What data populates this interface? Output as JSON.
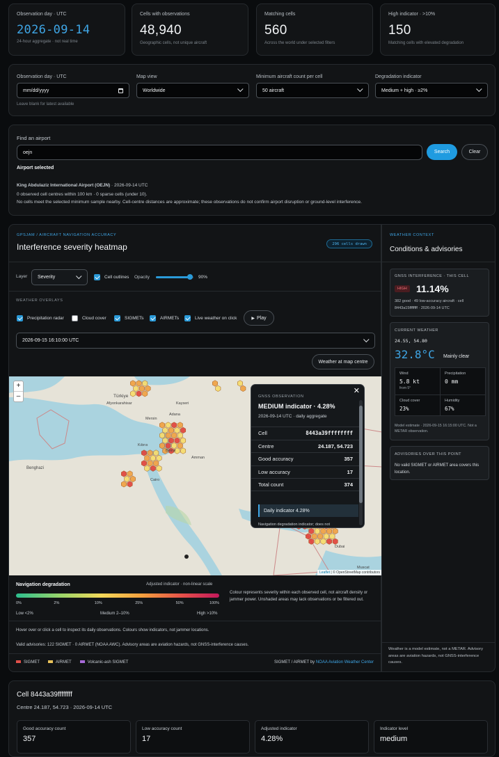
{
  "stats": [
    {
      "label": "Observation day · UTC",
      "value": "2026-09-14",
      "sub": "24-hour aggregate · not real time"
    },
    {
      "label": "Cells with observations",
      "value": "48,940",
      "sub": "Geographic cells, not unique aircraft"
    },
    {
      "label": "Matching cells",
      "value": "560",
      "sub": "Across the world under selected filters"
    },
    {
      "label": "High indicator · >10%",
      "value": "150",
      "sub": "Matching cells with elevated degradation"
    }
  ],
  "filters": {
    "day_label": "Observation day · UTC",
    "day_placeholder": "mm/dd/yyyy",
    "day_hint": "Leave blank for latest available",
    "view_label": "Map view",
    "view_value": "Worldwide",
    "min_label": "Minimum aircraft count per cell",
    "min_value": "50 aircraft",
    "deg_label": "Degradation indicator",
    "deg_value": "Medium + high · ≥2%"
  },
  "airport": {
    "title": "Find an airport",
    "query": "oejn",
    "search": "Search",
    "clear": "Clear",
    "selected": "Airport selected",
    "name": "King Abdulaziz International Airport (OEJN)",
    "date": " · 2026-09-14 UTC",
    "line2": "0 observed cell centres within 100 km · 0 sparse cells (under 10).",
    "line3": "No cells meet the selected minimum sample nearby. Cell-centre distances are approximate; these observations do not confirm airport disruption or ground-level interference."
  },
  "heatmap": {
    "eyebrow": "GPSJAM / AIRCRAFT NAVIGATION ACCURACY",
    "title": "Interference severity heatmap",
    "badge": "296 cells drawn",
    "layer_label": "Layer",
    "layer_value": "Severity",
    "outlines": "Cell outlines",
    "opacity_label": "Opacity",
    "opacity_value": "90%",
    "opacity_fraction": 0.9,
    "overlays_label": "WEATHER OVERLAYS",
    "overlays": [
      {
        "label": "Precipitation radar",
        "on": true
      },
      {
        "label": "Cloud cover",
        "on": false
      },
      {
        "label": "SIGMETs",
        "on": true
      },
      {
        "label": "AIRMETs",
        "on": true
      },
      {
        "label": "Live weather on click",
        "on": true
      }
    ],
    "play": "Play",
    "time_value": "2026-09-15 16:10:00 UTC",
    "centre_btn": "Weather at map centre",
    "zoom_in": "+",
    "zoom_out": "–",
    "attribution_a": "Leaflet",
    "attribution_b": " | © OpenStreetMap contributors",
    "legend_title": "Navigation degradation",
    "legend_note": "Adjusted indicator · non-linear scale",
    "ticks": [
      "0%",
      "2%",
      "10%",
      "25%",
      "50%",
      "100%"
    ],
    "levels": [
      "Low <2%",
      "Medium 2–10%",
      "High >10%"
    ],
    "legend_desc": "Colour represents severity within each observed cell, not aircraft density or jammer power. Unshaded areas may lack observations or be filtered out.",
    "hover_hint": "Hover over or click a cell to inspect its daily observations. Colours show indicators, not jammer locations.",
    "advisories": "Valid advisories: 122 SIGMET · 0 AIRMET (NOAA AWC). Advisory areas are aviation hazards, not GNSS-interference causes.",
    "keys": [
      {
        "label": "SIGMET",
        "color": "#e0504a"
      },
      {
        "label": "AIRMET",
        "color": "#e8c25a"
      },
      {
        "label": "Volcanic-ash SIGMET",
        "color": "#a76ad8"
      }
    ],
    "source_prefix": "SIGMET / AIRMET by",
    "source_link": "NOAA Aviation Weather Center"
  },
  "popup": {
    "eyebrow": "GNSS OBSERVATION",
    "title": "MEDIUM indicator · 4.28%",
    "subtitle": "2026-09-14 UTC · daily aggregate",
    "rows": [
      {
        "k": "Cell",
        "v": "8443a39ffffffff"
      },
      {
        "k": "Centre",
        "v": "24.187, 54.723"
      },
      {
        "k": "Good accuracy",
        "v": "357"
      },
      {
        "k": "Low accuracy",
        "v": "17"
      },
      {
        "k": "Total count",
        "v": "374"
      }
    ],
    "daily": "Daily indicator 4.28%",
    "note": "Navigation degradation indicator; does not"
  },
  "map_labels": [
    "Benghazi",
    "Türkiye",
    "Afyonkarahisar",
    "Kıbrıs",
    "Kayseri",
    "Beirut",
    "Mersin",
    "Adana",
    "Cairo",
    "Amman",
    "Dubai",
    "Muscat"
  ],
  "weather": {
    "eyebrow": "WEATHER CONTEXT",
    "title": "Conditions & advisories",
    "gnss_label": "GNSS INTERFERENCE · THIS CELL",
    "badge": "HIGH",
    "pct": "11.14%",
    "gnss_sub1": "382 good · 49 low-accuracy aircraft · cell",
    "gnss_sub2": "8443a15ffffffff · 2026-09-14 UTC",
    "cur_label": "CURRENT WEATHER",
    "coords": "24.55, 54.80",
    "temp": "32.8°C",
    "cond": "Mainly clear",
    "wind_l": "Wind",
    "wind_v": "5.8 kt",
    "wind_s": "from 5°",
    "prec_l": "Precipitation",
    "prec_v": "0 mm",
    "cloud_l": "Cloud cover",
    "cloud_v": "23%",
    "hum_l": "Humidity",
    "hum_v": "67%",
    "model_note": "Model estimate · 2026-09-15 16:15:00 UTC. Not a METAR observation.",
    "adv_label": "ADVISORIES OVER THIS POINT",
    "adv_text": "No valid SIGMET or AIRMET area covers this location.",
    "footer": "Weather is a model estimate, not a METAR. Advisory areas are aviation hazards, not GNSS-interference causes."
  },
  "cell": {
    "title": "Cell 8443a39ffffffff",
    "sub": "Centre 24.187, 54.723 · 2026-09-14 UTC",
    "metrics": [
      {
        "label": "Good accuracy count",
        "value": "357"
      },
      {
        "label": "Low accuracy count",
        "value": "17"
      },
      {
        "label": "Adjusted indicator",
        "value": "4.28%"
      },
      {
        "label": "Indicator level",
        "value": "medium"
      }
    ]
  },
  "colors": {
    "accent": "#2aa6e4",
    "high": "#e0403a",
    "medium": "#f0a040",
    "low": "#f6dc6a"
  }
}
